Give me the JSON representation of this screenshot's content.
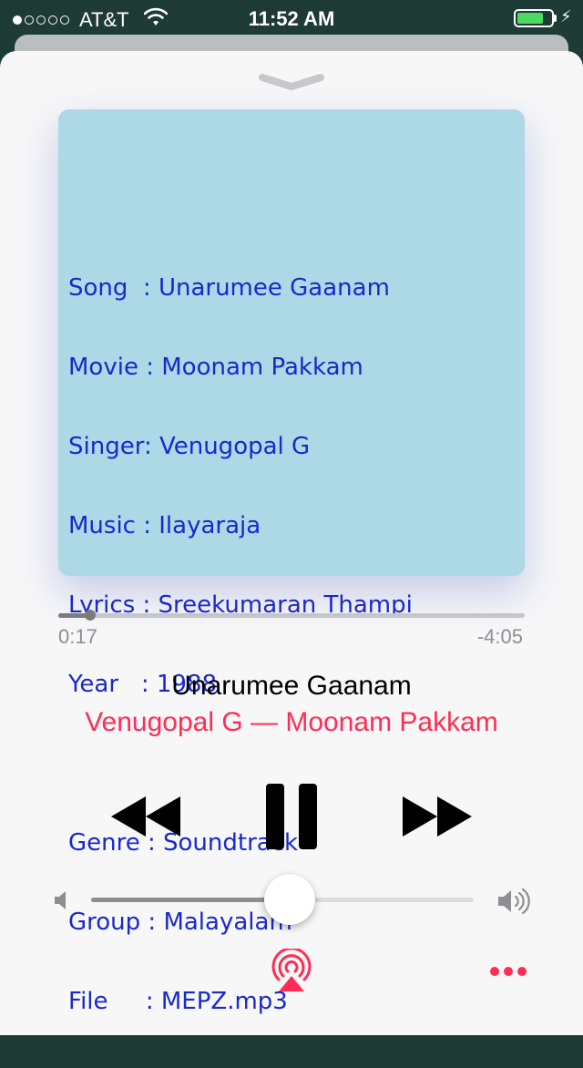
{
  "status_bar": {
    "carrier": "AT&T",
    "time": "11:52 AM",
    "signal_bars_filled": 1,
    "signal_bars_total": 5,
    "battery_level": 0.8,
    "icons": [
      "wifi-icon",
      "battery-icon",
      "charging-bolt-icon"
    ]
  },
  "artwork": {
    "lines": [
      "Song  : Unarumee Gaanam",
      "Movie : Moonam Pakkam",
      "Singer: Venugopal G",
      "Music : Ilayaraja",
      "Lyrics : Sreekumaran Thampi",
      "Year   : 1988",
      "",
      "Genre : Soundtrack",
      "Group : Malayalam",
      "File     : MEPZ.mp3"
    ],
    "background": "#add8e6",
    "text_color": "#1a28cc"
  },
  "playback": {
    "elapsed": "0:17",
    "remaining": "-4:05",
    "progress": 0.068
  },
  "now_playing": {
    "title": "Unarumee Gaanam",
    "subtitle": "Venugopal G — Moonam Pakkam"
  },
  "controls": {
    "icons": [
      "rewind-icon",
      "pause-icon",
      "fast-forward-icon"
    ]
  },
  "volume": {
    "level": 0.52,
    "icons": [
      "volume-low-icon",
      "volume-high-icon"
    ]
  },
  "bottom_bar": {
    "icons": [
      "airplay-icon",
      "more-icon"
    ]
  },
  "colors": {
    "accent": "#ff2d55",
    "track": "#c6c6c9",
    "track_fill": "#7b7b7e",
    "secondary_text": "#8e8e93"
  }
}
